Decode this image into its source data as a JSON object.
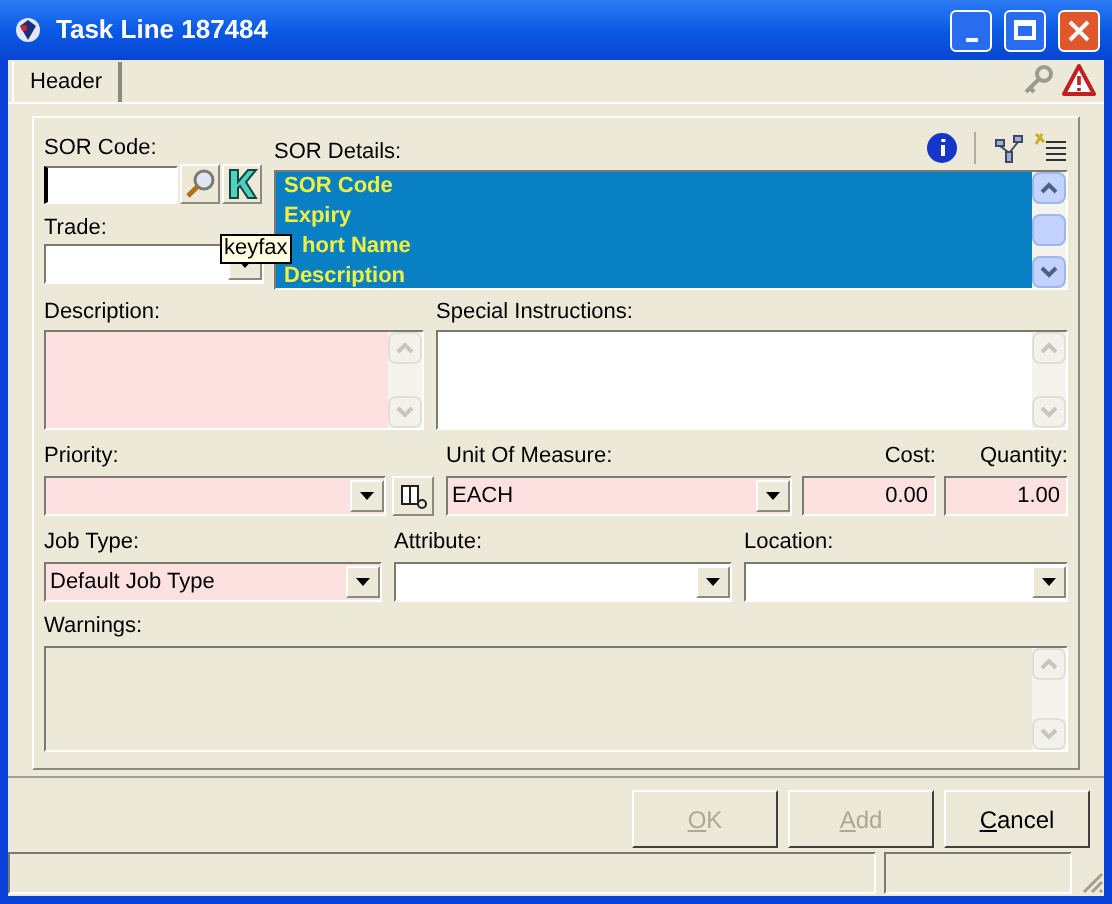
{
  "window": {
    "title": "Task Line 187484"
  },
  "tabs": [
    {
      "label": "Header",
      "selected": true
    }
  ],
  "sor_code": {
    "label": "SOR Code:"
  },
  "tooltip": "keyfax",
  "sor_details": {
    "label": "SOR Details:",
    "lines": [
      "SOR Code",
      "Expiry",
      "hort Name",
      "Description"
    ]
  },
  "trade": {
    "label": "Trade:",
    "required": false
  },
  "description": {
    "label": "Description:",
    "required": true
  },
  "special_instructions": {
    "label": "Special Instructions:",
    "required": false
  },
  "priority": {
    "label": "Priority:",
    "required": true
  },
  "unit_of_measure": {
    "label": "Unit Of Measure:",
    "value": "EACH",
    "required": true
  },
  "cost": {
    "label": "Cost:",
    "value": "0.00",
    "required": true
  },
  "quantity": {
    "label": "Quantity:",
    "value": "1.00",
    "required": true
  },
  "job_type": {
    "label": "Job Type:",
    "value": "Default Job Type",
    "required": true
  },
  "attribute": {
    "label": "Attribute:",
    "required": false
  },
  "location": {
    "label": "Location:",
    "required": false
  },
  "warnings": {
    "label": "Warnings:"
  },
  "buttons": [
    {
      "label": "OK",
      "disabled": true
    },
    {
      "label": "Add",
      "disabled": true
    },
    {
      "label": "Cancel",
      "disabled": false
    }
  ]
}
